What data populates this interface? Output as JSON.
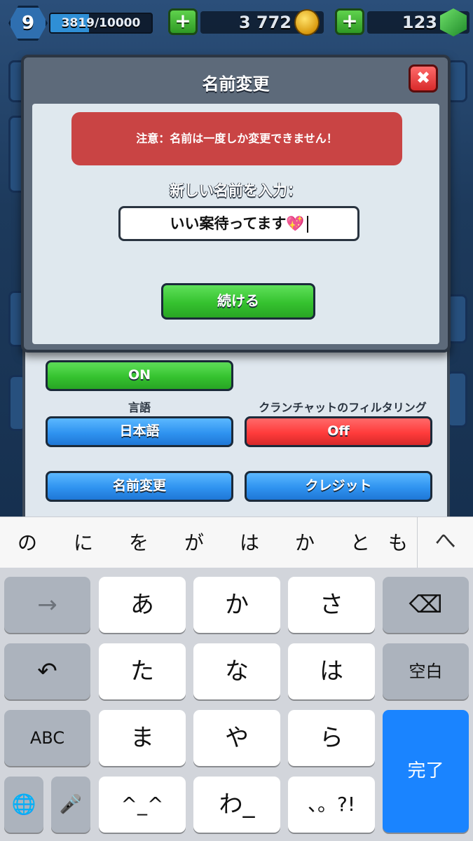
{
  "topbar": {
    "level": "9",
    "xp_text": "3819/10000",
    "xp_progress": 0.3819,
    "gold_amount": "3 772",
    "gems_amount": "123",
    "plus_symbol": "+"
  },
  "settings": {
    "toggle_on_label": "ON",
    "language_label": "言語",
    "language_value": "日本語",
    "clan_filter_label": "クランチャットのフィルタリング",
    "clan_filter_value": "Off",
    "rename_button": "名前変更",
    "credits_button": "クレジット"
  },
  "dialog": {
    "title": "名前変更",
    "close_symbol": "✖",
    "warning": "注意：名前は一度しか変更できません！",
    "input_label": "新しい名前を入力：",
    "input_value": "いい案待ってます💖",
    "continue_button": "続ける"
  },
  "keyboard": {
    "suggestions": [
      "の",
      "に",
      "を",
      "が",
      "は",
      "か",
      "と",
      "も"
    ],
    "suggest_toggle": "へ",
    "keys": {
      "arrow_right": "→",
      "a": "あ",
      "ka": "か",
      "sa": "さ",
      "backspace": "⌫",
      "undo": "↶",
      "ta": "た",
      "na": "な",
      "ha": "は",
      "space": "空白",
      "abc": "ABC",
      "ma": "ま",
      "ya": "や",
      "ra": "ら",
      "done": "完了",
      "globe": "🌐",
      "mic": "🎤",
      "kaomoji": "^_^",
      "wa": "わ_",
      "punct": "、。?!"
    }
  },
  "colors": {
    "green_button": "#35c22f",
    "blue_button": "#2f93f0",
    "red_button": "#ff3b3b",
    "warning_bg": "#c94444",
    "done_key": "#1a84ff"
  }
}
